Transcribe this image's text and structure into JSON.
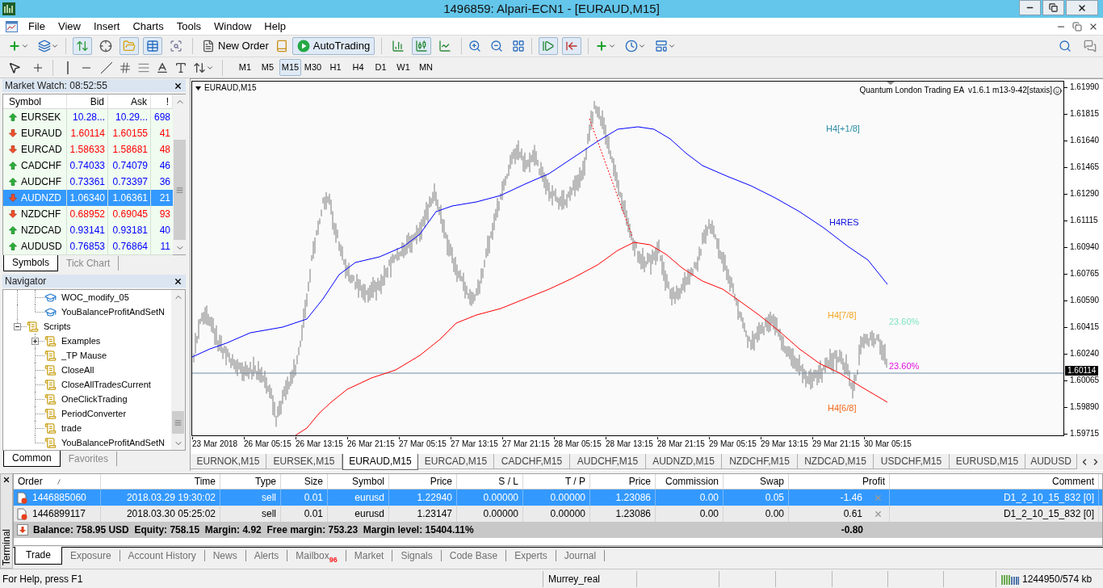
{
  "window": {
    "title": "1496859: Alpari-ECN1 - [EURAUD,M15]"
  },
  "menu": [
    "File",
    "View",
    "Insert",
    "Charts",
    "Tools",
    "Window",
    "Help"
  ],
  "toolbar": {
    "panel_toggles": [
      {
        "on": true
      },
      {
        "on": false
      },
      {
        "on": true
      },
      {
        "on": true
      },
      {
        "on": false
      }
    ],
    "new_order": "New Order",
    "autotrading": {
      "label": "AutoTrading",
      "on": true
    },
    "chart_types": [
      {
        "selected": false
      },
      {
        "selected": true
      },
      {
        "selected": false
      }
    ],
    "scroll_toggles": [
      {
        "on": true
      },
      {
        "on": true
      }
    ]
  },
  "timeframes": [
    {
      "label": "M1",
      "selected": false
    },
    {
      "label": "M5",
      "selected": false
    },
    {
      "label": "M15",
      "selected": true
    },
    {
      "label": "M30",
      "selected": false
    },
    {
      "label": "H1",
      "selected": false
    },
    {
      "label": "H4",
      "selected": false
    },
    {
      "label": "D1",
      "selected": false
    },
    {
      "label": "W1",
      "selected": false
    },
    {
      "label": "MN",
      "selected": false
    }
  ],
  "market_watch": {
    "title": "Market Watch: 08:52:55",
    "columns": [
      "Symbol",
      "Bid",
      "Ask",
      "!"
    ],
    "rows": [
      {
        "symbol": "EURSEK",
        "bid": "10.28...",
        "ask": "10.29...",
        "spread": "698",
        "rising": true,
        "selected": false
      },
      {
        "symbol": "EURAUD",
        "bid": "1.60114",
        "ask": "1.60155",
        "spread": "41",
        "rising": false,
        "selected": false
      },
      {
        "symbol": "EURCAD",
        "bid": "1.58633",
        "ask": "1.58681",
        "spread": "48",
        "rising": false,
        "selected": false
      },
      {
        "symbol": "CADCHF",
        "bid": "0.74033",
        "ask": "0.74079",
        "spread": "46",
        "rising": true,
        "selected": false
      },
      {
        "symbol": "AUDCHF",
        "bid": "0.73361",
        "ask": "0.73397",
        "spread": "36",
        "rising": true,
        "selected": false
      },
      {
        "symbol": "AUDNZD",
        "bid": "1.06340",
        "ask": "1.06361",
        "spread": "21",
        "rising": false,
        "selected": true
      },
      {
        "symbol": "NZDCHF",
        "bid": "0.68952",
        "ask": "0.69045",
        "spread": "93",
        "rising": false,
        "selected": false
      },
      {
        "symbol": "NZDCAD",
        "bid": "0.93141",
        "ask": "0.93181",
        "spread": "40",
        "rising": true,
        "selected": false
      },
      {
        "symbol": "AUDUSD",
        "bid": "0.76853",
        "ask": "0.76864",
        "spread": "11",
        "rising": true,
        "selected": false
      }
    ],
    "tabs": [
      {
        "label": "Symbols",
        "selected": true
      },
      {
        "label": "Tick Chart",
        "selected": false
      }
    ]
  },
  "navigator": {
    "title": "Navigator",
    "tree": [
      {
        "children": [
          {
            "label": "WOC_modify_05",
            "kind": "expert"
          },
          {
            "label": "YouBalanceProfitAndSetN",
            "kind": "expert"
          }
        ]
      },
      {
        "label": "Scripts",
        "kind": "folder",
        "expanded": true,
        "children": [
          {
            "label": "Examples",
            "kind": "folder",
            "expanded": false
          },
          {
            "label": "_TP Mause",
            "kind": "script"
          },
          {
            "label": "CloseAll",
            "kind": "script"
          },
          {
            "label": "CloseAllTradesCurrent",
            "kind": "script"
          },
          {
            "label": "OneClickTrading",
            "kind": "script"
          },
          {
            "label": "PeriodConverter",
            "kind": "script"
          },
          {
            "label": "trade",
            "kind": "script"
          },
          {
            "label": "YouBalanceProfitAndSetN",
            "kind": "script"
          }
        ]
      }
    ],
    "tabs": [
      {
        "label": "Common",
        "selected": true
      },
      {
        "label": "Favorites",
        "selected": false
      }
    ]
  },
  "chart": {
    "title": "EURAUD,M15",
    "expert": "Quantum London Trading EA  v1.6.1 m13-9-42[staxis]",
    "levels": [
      {
        "label": "H4[+1/8]",
        "color": "#2e8ea6"
      },
      {
        "label": "H4RES",
        "color": "#1414dc"
      },
      {
        "label": "H4[7/8]",
        "color": "#f5a623"
      },
      {
        "label": "23.60%",
        "color": "#7fe3c4"
      },
      {
        "label": "23.60%",
        "color": "#e010e0"
      },
      {
        "label": "H4[6/8]",
        "color": "#f26a1b"
      }
    ],
    "price_axis": [
      "1.61990",
      "1.61815",
      "1.61640",
      "1.61465",
      "1.61290",
      "1.61115",
      "1.60940",
      "1.60765",
      "1.60590",
      "1.60415",
      "1.60240",
      "1.60065",
      "1.59890",
      "1.59715"
    ],
    "current_price": "1.60114",
    "time_axis": [
      "23 Mar 2018",
      "26 Mar 05:15",
      "26 Mar 13:15",
      "26 Mar 21:15",
      "27 Mar 05:15",
      "27 Mar 13:15",
      "27 Mar 21:15",
      "28 Mar 05:15",
      "28 Mar 13:15",
      "28 Mar 21:15",
      "29 Mar 05:15",
      "29 Mar 13:15",
      "29 Mar 21:15",
      "30 Mar 05:15"
    ]
  },
  "chart_tabs": [
    {
      "label": "EURNOK,M15",
      "selected": false
    },
    {
      "label": "EURSEK,M15",
      "selected": false
    },
    {
      "label": "EURAUD,M15",
      "selected": true
    },
    {
      "label": "EURCAD,M15",
      "selected": false
    },
    {
      "label": "CADCHF,M15",
      "selected": false
    },
    {
      "label": "AUDCHF,M15",
      "selected": false
    },
    {
      "label": "AUDNZD,M15",
      "selected": false
    },
    {
      "label": "NZDCHF,M15",
      "selected": false
    },
    {
      "label": "NZDCAD,M15",
      "selected": false
    },
    {
      "label": "USDCHF,M15",
      "selected": false
    },
    {
      "label": "EURUSD,M15",
      "selected": false
    },
    {
      "label": "AUDUSD",
      "selected": false
    }
  ],
  "terminal": {
    "title": "Terminal",
    "columns": [
      "Order",
      "Time",
      "Type",
      "Size",
      "Symbol",
      "Price",
      "S / L",
      "T / P",
      "Price",
      "Commission",
      "Swap",
      "Profit",
      "Comment"
    ],
    "rows": [
      {
        "selected": true,
        "cells": [
          "1446885060",
          "2018.03.29 19:30:02",
          "sell",
          "0.01",
          "eurusd",
          "1.22940",
          "0.00000",
          "0.00000",
          "1.23086",
          "0.00",
          "0.05",
          "-1.46",
          "D1_2_10_15_832 [0]"
        ]
      },
      {
        "selected": false,
        "cells": [
          "1446899117",
          "2018.03.30 05:25:02",
          "sell",
          "0.01",
          "eurusd",
          "1.23147",
          "0.00000",
          "0.00000",
          "1.23086",
          "0.00",
          "0.00",
          "0.61",
          "D1_2_10_15_832 [0]"
        ]
      }
    ],
    "summary": {
      "text": "Balance: 758.95 USD  Equity: 758.15  Margin: 4.92  Free margin: 753.23  Margin level: 15404.11%",
      "profit": "-0.80"
    },
    "tabs": [
      {
        "label": "Trade",
        "selected": true
      },
      {
        "label": "Exposure",
        "selected": false
      },
      {
        "label": "Account History",
        "selected": false
      },
      {
        "label": "News",
        "selected": false
      },
      {
        "label": "Alerts",
        "selected": false
      },
      {
        "label": "Mailbox",
        "badge": "96",
        "selected": false
      },
      {
        "label": "Market",
        "selected": false
      },
      {
        "label": "Signals",
        "selected": false
      },
      {
        "label": "Code Base",
        "selected": false
      },
      {
        "label": "Experts",
        "selected": false
      },
      {
        "label": "Journal",
        "selected": false
      }
    ]
  },
  "status_bar": {
    "help": "For Help, press F1",
    "profile": "Murrey_real",
    "traffic": "1244950/574 kb"
  }
}
